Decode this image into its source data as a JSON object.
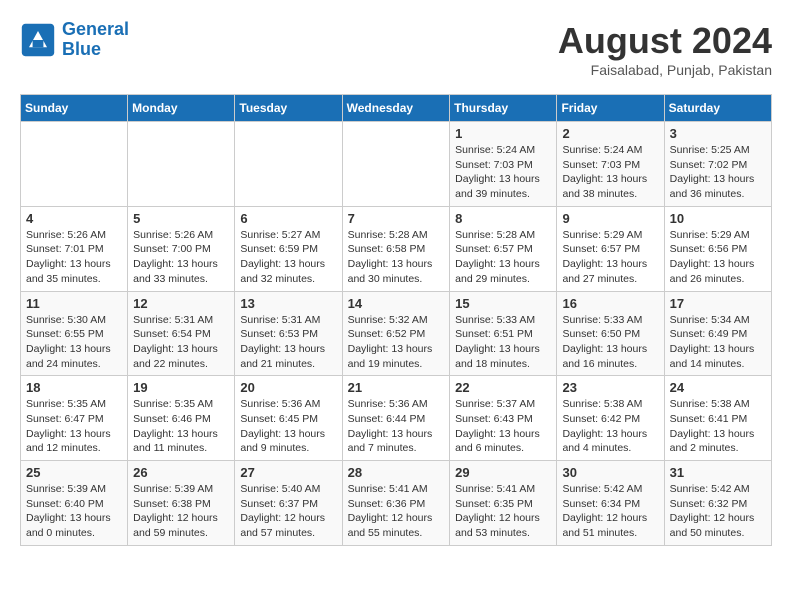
{
  "header": {
    "logo_line1": "General",
    "logo_line2": "Blue",
    "month": "August 2024",
    "location": "Faisalabad, Punjab, Pakistan"
  },
  "days_of_week": [
    "Sunday",
    "Monday",
    "Tuesday",
    "Wednesday",
    "Thursday",
    "Friday",
    "Saturday"
  ],
  "weeks": [
    [
      {
        "num": "",
        "detail": ""
      },
      {
        "num": "",
        "detail": ""
      },
      {
        "num": "",
        "detail": ""
      },
      {
        "num": "",
        "detail": ""
      },
      {
        "num": "1",
        "detail": "Sunrise: 5:24 AM\nSunset: 7:03 PM\nDaylight: 13 hours\nand 39 minutes."
      },
      {
        "num": "2",
        "detail": "Sunrise: 5:24 AM\nSunset: 7:03 PM\nDaylight: 13 hours\nand 38 minutes."
      },
      {
        "num": "3",
        "detail": "Sunrise: 5:25 AM\nSunset: 7:02 PM\nDaylight: 13 hours\nand 36 minutes."
      }
    ],
    [
      {
        "num": "4",
        "detail": "Sunrise: 5:26 AM\nSunset: 7:01 PM\nDaylight: 13 hours\nand 35 minutes."
      },
      {
        "num": "5",
        "detail": "Sunrise: 5:26 AM\nSunset: 7:00 PM\nDaylight: 13 hours\nand 33 minutes."
      },
      {
        "num": "6",
        "detail": "Sunrise: 5:27 AM\nSunset: 6:59 PM\nDaylight: 13 hours\nand 32 minutes."
      },
      {
        "num": "7",
        "detail": "Sunrise: 5:28 AM\nSunset: 6:58 PM\nDaylight: 13 hours\nand 30 minutes."
      },
      {
        "num": "8",
        "detail": "Sunrise: 5:28 AM\nSunset: 6:57 PM\nDaylight: 13 hours\nand 29 minutes."
      },
      {
        "num": "9",
        "detail": "Sunrise: 5:29 AM\nSunset: 6:57 PM\nDaylight: 13 hours\nand 27 minutes."
      },
      {
        "num": "10",
        "detail": "Sunrise: 5:29 AM\nSunset: 6:56 PM\nDaylight: 13 hours\nand 26 minutes."
      }
    ],
    [
      {
        "num": "11",
        "detail": "Sunrise: 5:30 AM\nSunset: 6:55 PM\nDaylight: 13 hours\nand 24 minutes."
      },
      {
        "num": "12",
        "detail": "Sunrise: 5:31 AM\nSunset: 6:54 PM\nDaylight: 13 hours\nand 22 minutes."
      },
      {
        "num": "13",
        "detail": "Sunrise: 5:31 AM\nSunset: 6:53 PM\nDaylight: 13 hours\nand 21 minutes."
      },
      {
        "num": "14",
        "detail": "Sunrise: 5:32 AM\nSunset: 6:52 PM\nDaylight: 13 hours\nand 19 minutes."
      },
      {
        "num": "15",
        "detail": "Sunrise: 5:33 AM\nSunset: 6:51 PM\nDaylight: 13 hours\nand 18 minutes."
      },
      {
        "num": "16",
        "detail": "Sunrise: 5:33 AM\nSunset: 6:50 PM\nDaylight: 13 hours\nand 16 minutes."
      },
      {
        "num": "17",
        "detail": "Sunrise: 5:34 AM\nSunset: 6:49 PM\nDaylight: 13 hours\nand 14 minutes."
      }
    ],
    [
      {
        "num": "18",
        "detail": "Sunrise: 5:35 AM\nSunset: 6:47 PM\nDaylight: 13 hours\nand 12 minutes."
      },
      {
        "num": "19",
        "detail": "Sunrise: 5:35 AM\nSunset: 6:46 PM\nDaylight: 13 hours\nand 11 minutes."
      },
      {
        "num": "20",
        "detail": "Sunrise: 5:36 AM\nSunset: 6:45 PM\nDaylight: 13 hours\nand 9 minutes."
      },
      {
        "num": "21",
        "detail": "Sunrise: 5:36 AM\nSunset: 6:44 PM\nDaylight: 13 hours\nand 7 minutes."
      },
      {
        "num": "22",
        "detail": "Sunrise: 5:37 AM\nSunset: 6:43 PM\nDaylight: 13 hours\nand 6 minutes."
      },
      {
        "num": "23",
        "detail": "Sunrise: 5:38 AM\nSunset: 6:42 PM\nDaylight: 13 hours\nand 4 minutes."
      },
      {
        "num": "24",
        "detail": "Sunrise: 5:38 AM\nSunset: 6:41 PM\nDaylight: 13 hours\nand 2 minutes."
      }
    ],
    [
      {
        "num": "25",
        "detail": "Sunrise: 5:39 AM\nSunset: 6:40 PM\nDaylight: 13 hours\nand 0 minutes."
      },
      {
        "num": "26",
        "detail": "Sunrise: 5:39 AM\nSunset: 6:38 PM\nDaylight: 12 hours\nand 59 minutes."
      },
      {
        "num": "27",
        "detail": "Sunrise: 5:40 AM\nSunset: 6:37 PM\nDaylight: 12 hours\nand 57 minutes."
      },
      {
        "num": "28",
        "detail": "Sunrise: 5:41 AM\nSunset: 6:36 PM\nDaylight: 12 hours\nand 55 minutes."
      },
      {
        "num": "29",
        "detail": "Sunrise: 5:41 AM\nSunset: 6:35 PM\nDaylight: 12 hours\nand 53 minutes."
      },
      {
        "num": "30",
        "detail": "Sunrise: 5:42 AM\nSunset: 6:34 PM\nDaylight: 12 hours\nand 51 minutes."
      },
      {
        "num": "31",
        "detail": "Sunrise: 5:42 AM\nSunset: 6:32 PM\nDaylight: 12 hours\nand 50 minutes."
      }
    ]
  ]
}
